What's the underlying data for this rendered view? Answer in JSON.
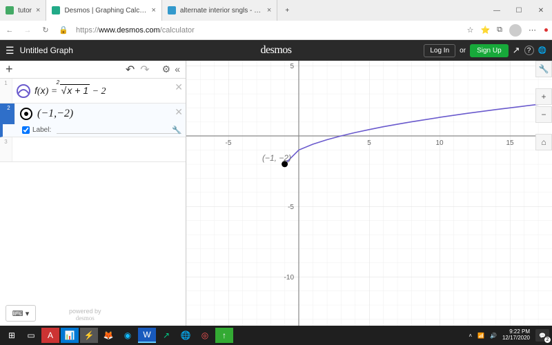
{
  "tabs": [
    {
      "label": "tutor",
      "icon": "N"
    },
    {
      "label": "Desmos | Graphing Calculator",
      "icon": "D"
    },
    {
      "label": "alternate interior sngls - Bing",
      "icon": "b"
    }
  ],
  "window": {
    "min": "—",
    "max": "☐",
    "close": "✕",
    "add": "+"
  },
  "address": {
    "back": "←",
    "fwd": "→",
    "refresh": "↻",
    "lock": "🔒",
    "url_pre": "https://",
    "url_host": "www.desmos.com",
    "url_path": "/calculator",
    "star": "☆",
    "fav": "⭐",
    "ext": "⧉",
    "menu": "⋯"
  },
  "appbar": {
    "title": "Untitled Graph",
    "logo": "desmos",
    "login": "Log In",
    "or": "or",
    "signup": "Sign Up",
    "share": "↗",
    "help": "?",
    "lang": "🌐"
  },
  "expr": {
    "plus": "+",
    "undo": "↶",
    "redo": "↷",
    "gear": "⚙",
    "collapse": "«",
    "row1_math": "f(x) = ²√(x+1) − 2",
    "row2_math": "(−1,−2)",
    "label_text": "Label:",
    "close": "✕",
    "kbd": "⌨ ▾",
    "powered1": "powered by",
    "powered2": "desmos"
  },
  "graph": {
    "point_label": "(−1, −2)",
    "xticks": [
      "-5",
      "5",
      "10",
      "15"
    ],
    "yticks": [
      "5",
      "-5",
      "-10"
    ],
    "tools": {
      "wrench": "🔧",
      "plus": "+",
      "minus": "−",
      "home": "⌂"
    }
  },
  "chart_data": {
    "type": "line",
    "title": "",
    "xlabel": "",
    "ylabel": "",
    "xlim": [
      -8,
      18
    ],
    "ylim": [
      -14,
      6
    ],
    "series": [
      {
        "name": "f(x)=sqrt(x+1)-2",
        "x": [
          -1,
          0,
          1,
          2,
          3,
          4,
          5,
          6,
          7,
          8,
          10,
          12,
          14,
          16,
          18
        ],
        "values": [
          -2,
          -1,
          -0.59,
          -0.27,
          0,
          0.24,
          0.45,
          0.65,
          0.83,
          1,
          1.32,
          1.61,
          1.87,
          2.12,
          2.36
        ]
      }
    ],
    "points": [
      {
        "x": -1,
        "y": -2,
        "label": "(-1,-2)"
      }
    ]
  },
  "taskbar": {
    "time": "9:22 PM",
    "date": "12/17/2020",
    "notif": "2"
  }
}
